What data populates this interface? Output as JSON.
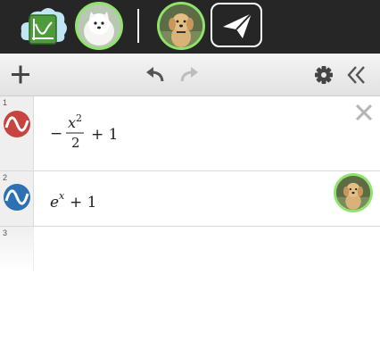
{
  "topbar": {
    "icons": [
      "app-logo-icon",
      "user-avatar-white-dog",
      "user-avatar-golden-dog",
      "send-icon"
    ],
    "avatar_ring_color": "#8fe36a"
  },
  "toolbar": {
    "icons": [
      "plus-icon",
      "undo-icon",
      "redo-icon",
      "gear-icon",
      "double-chevron-left-icon"
    ],
    "redo_enabled": false
  },
  "expressions": [
    {
      "number": "1",
      "color": "#c74440",
      "latex": "-\\frac{x^{2}}{2}+1",
      "parts": {
        "sign": "−",
        "numerator_base": "x",
        "numerator_exp": "2",
        "denominator": "2",
        "tail": "+ 1"
      }
    },
    {
      "number": "2",
      "color": "#2d70b3",
      "latex": "e^{x}+1",
      "parts": {
        "base": "e",
        "exp": "x",
        "tail": "+ 1"
      }
    },
    {
      "number": "3"
    }
  ]
}
